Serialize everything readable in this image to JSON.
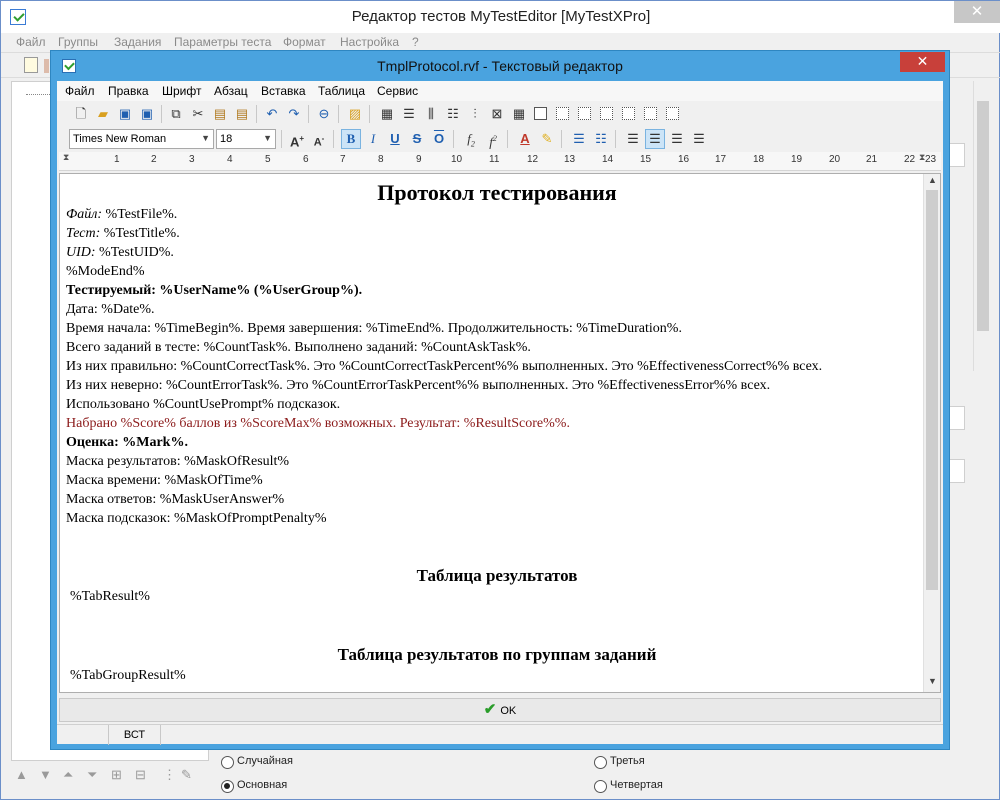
{
  "main_window": {
    "title": "Редактор тестов MyTestEditor [MyTestXPro]",
    "close_glyph": "✕",
    "menu": [
      "Файл",
      "Группы",
      "Задания",
      "Параметры теста",
      "Формат",
      "Настройка",
      "?"
    ],
    "radio_options": [
      {
        "label": "Случайная",
        "checked": false
      },
      {
        "label": "Третья",
        "checked": false
      },
      {
        "label": "Основная",
        "checked": true
      },
      {
        "label": "Четвертая",
        "checked": false
      }
    ]
  },
  "editor": {
    "title": "TmplProtocol.rvf - Текстовый редактор",
    "close_glyph": "✕",
    "menu": [
      "Файл",
      "Правка",
      "Шрифт",
      "Абзац",
      "Вставка",
      "Таблица",
      "Сервис"
    ],
    "font_name": "Times New Roman",
    "font_size": "18",
    "ruler_numbers": [
      "1",
      "2",
      "3",
      "4",
      "5",
      "6",
      "7",
      "8",
      "9",
      "10",
      "11",
      "12",
      "13",
      "14",
      "15",
      "16",
      "17",
      "18",
      "19",
      "20",
      "21",
      "22",
      "23"
    ],
    "document": {
      "title": "Протокол тестирования",
      "file_label": "Файл:",
      "file_value": " %TestFile%.",
      "test_label": "Тест:",
      "test_value": " %TestTitle%.",
      "uid_label": "UID:",
      "uid_value": " %TestUID%.",
      "mode_end": "%ModeEnd%",
      "tested": "Тестируемый: %UserName% (%UserGroup%).",
      "date": "Дата: %Date%.",
      "time_line": "Время начала: %TimeBegin%. Время завершения: %TimeEnd%. Продолжительность: %TimeDuration%.",
      "tasks_line": "Всего заданий в тесте: %CountTask%. Выполнено заданий: %CountAskTask%.",
      "correct_line": "Из них правильно: %CountCorrectTask%. Это %CountCorrectTaskPercent%%  выполненных. Это %EffectivenessCorrect%% всех.",
      "wrong_line": "Из них неверно: %CountErrorTask%. Это %CountErrorTaskPercent%%  выполненных. Это %EffectivenessError%% всех.",
      "prompt_line": "Использовано %CountUsePrompt% подсказок.",
      "score_line": "Набрано %Score% баллов из %ScoreMax% возможных. Результат: %ResultScore%%.",
      "mark_line": "Оценка: %Mark%.",
      "mask_result": "Маска результатов: %MaskOfResult%",
      "mask_time": "Маска времени: %MaskOfTime%",
      "mask_answer": "Маска ответов: %MaskUserAnswer%",
      "mask_prompt": "Маска подсказок:  %MaskOfPromptPenalty%",
      "results_table_title": "Таблица результатов",
      "results_table_tag": "%TabResult%",
      "group_table_title": "Таблица результатов по группам заданий",
      "group_table_tag": "%TabGroupResult%"
    },
    "ok_label": "OK",
    "status_mode": "ВСТ"
  },
  "colors": {
    "dialog_frame": "#4aa3df",
    "close_button": "#c8403a",
    "score_text": "#8b1a1a",
    "ok_check": "#2a9d2a"
  }
}
